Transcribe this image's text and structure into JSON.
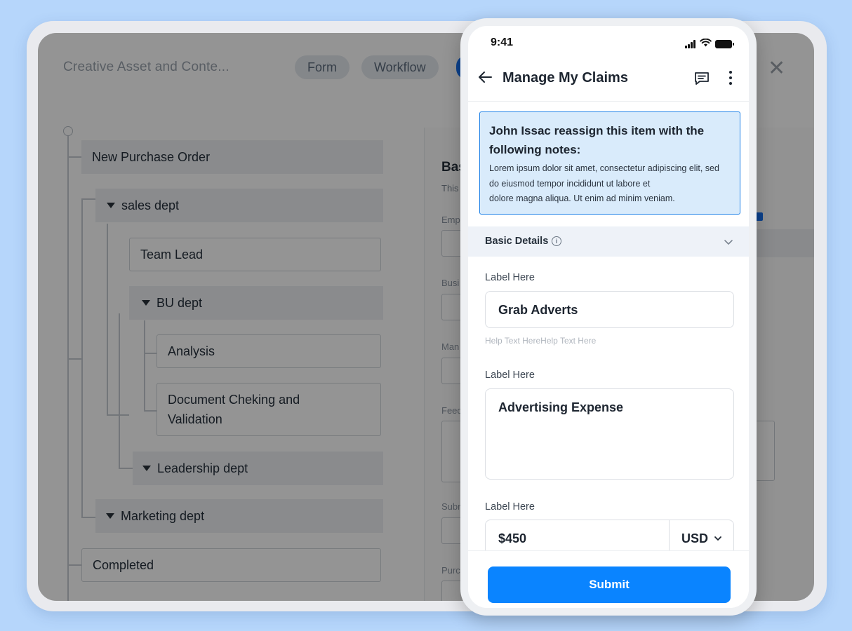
{
  "desktop": {
    "app_title": "Creative Asset and Conte...",
    "tabs": [
      {
        "label": "Form"
      },
      {
        "label": "Workflow"
      }
    ],
    "tree": {
      "nodes": [
        {
          "label": "New Purchase Order"
        },
        {
          "label": "sales dept"
        },
        {
          "label": "Team Lead"
        },
        {
          "label": "BU dept"
        },
        {
          "label": "Analysis"
        },
        {
          "label": "Document Cheking and Validation"
        },
        {
          "label": "Leadership dept"
        },
        {
          "label": "Marketing dept"
        },
        {
          "label": "Completed"
        }
      ]
    },
    "right_pane": {
      "heading": "Bas",
      "subtitle": "This",
      "labels": [
        "Emp",
        "Busi",
        "Man",
        "Feed",
        "Subr",
        "Purc"
      ]
    }
  },
  "phone": {
    "status_time": "9:41",
    "nav_title": "Manage My Claims",
    "note": {
      "title": "John Issac reassign this item with the following notes:",
      "lines": [
        "Lorem ipsum dolor sit amet, consectetur adipiscing elit, sed",
        "do eiusmod tempor incididunt ut labore et",
        "dolore magna aliqua. Ut enim ad minim veniam."
      ]
    },
    "section_title": "Basic Details",
    "fields": [
      {
        "label": "Label Here",
        "value": "Grab Adverts",
        "help": "Help Text HereHelp Text Here"
      },
      {
        "label": "Label Here",
        "value": "Advertising Expense"
      },
      {
        "label": "Label Here",
        "value": "$450",
        "currency": "USD"
      }
    ],
    "submit_label": "Submit"
  },
  "colors": {
    "background": "#b6d6fb",
    "accent": "#0a84ff",
    "note_bg": "#d9ebfb",
    "note_border": "#1f82e7"
  }
}
